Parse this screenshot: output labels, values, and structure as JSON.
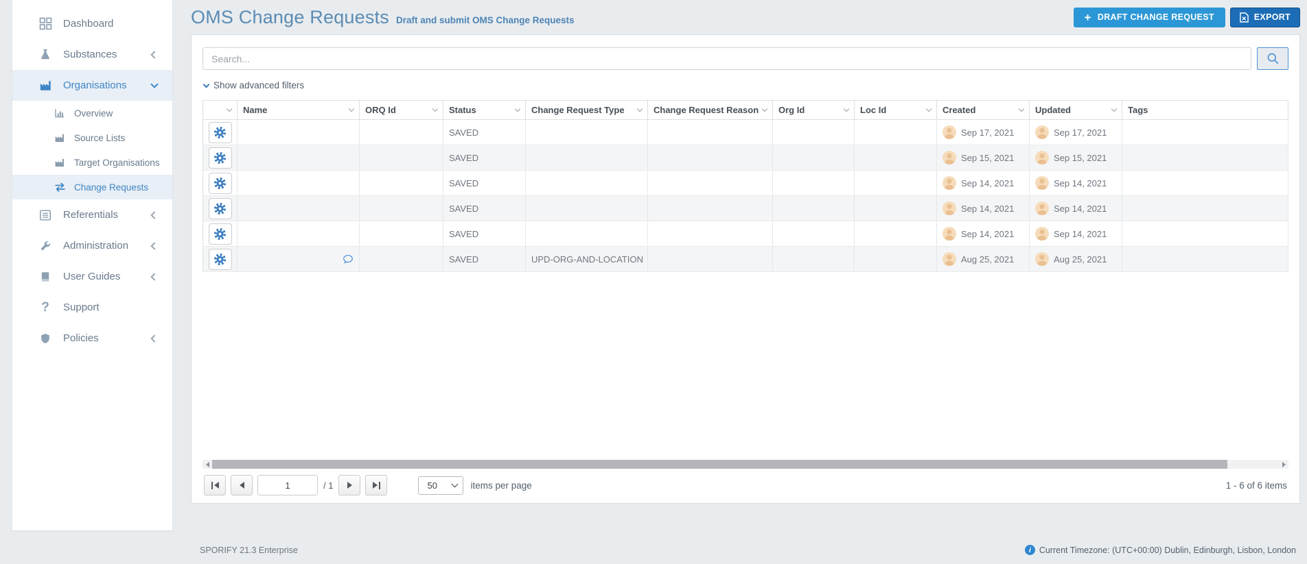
{
  "page": {
    "title": "OMS Change Requests",
    "subtitle": "Draft and submit OMS Change Requests",
    "draft_button": "DRAFT CHANGE REQUEST",
    "export_button": "EXPORT"
  },
  "colors": {
    "accent_blue": "#3e86c6",
    "title_blue": "#5b8cb4",
    "draft_button_bg": "#2c97d6",
    "export_button_bg": "#1d6db6"
  },
  "sidebar": {
    "items": [
      {
        "label": "Dashboard"
      },
      {
        "label": "Substances"
      },
      {
        "label": "Organisations"
      },
      {
        "label": "Referentials"
      },
      {
        "label": "Administration"
      },
      {
        "label": "User Guides"
      },
      {
        "label": "Support"
      },
      {
        "label": "Policies"
      }
    ],
    "submenu": [
      {
        "label": "Overview"
      },
      {
        "label": "Source Lists"
      },
      {
        "label": "Target Organisations"
      },
      {
        "label": "Change Requests"
      }
    ]
  },
  "search": {
    "placeholder": "Search..."
  },
  "filters": {
    "toggle_label": "Show advanced filters"
  },
  "table": {
    "columns": [
      "Name",
      "ORQ Id",
      "Status",
      "Change Request Type",
      "Change Request Reason",
      "Org Id",
      "Loc Id",
      "Created",
      "Updated",
      "Tags"
    ],
    "rows": [
      {
        "status": "SAVED",
        "change_request_type": "",
        "created": "Sep 17, 2021",
        "updated": "Sep 17, 2021"
      },
      {
        "status": "SAVED",
        "change_request_type": "",
        "created": "Sep 15, 2021",
        "updated": "Sep 15, 2021"
      },
      {
        "status": "SAVED",
        "change_request_type": "",
        "created": "Sep 14, 2021",
        "updated": "Sep 14, 2021"
      },
      {
        "status": "SAVED",
        "change_request_type": "",
        "created": "Sep 14, 2021",
        "updated": "Sep 14, 2021"
      },
      {
        "status": "SAVED",
        "change_request_type": "",
        "created": "Sep 14, 2021",
        "updated": "Sep 14, 2021"
      },
      {
        "status": "SAVED",
        "change_request_type": "UPD-ORG-AND-LOCATION",
        "created": "Aug 25, 2021",
        "updated": "Aug 25, 2021"
      }
    ]
  },
  "pagination": {
    "page": "1",
    "total_label": "/ 1",
    "per_page": "50",
    "per_page_label": "items per page",
    "range_label": "1 - 6 of 6 items"
  },
  "footer": {
    "left": "SPORIFY 21.3 Enterprise",
    "right": "Current Timezone: (UTC+00:00) Dublin, Edinburgh, Lisbon, London"
  }
}
